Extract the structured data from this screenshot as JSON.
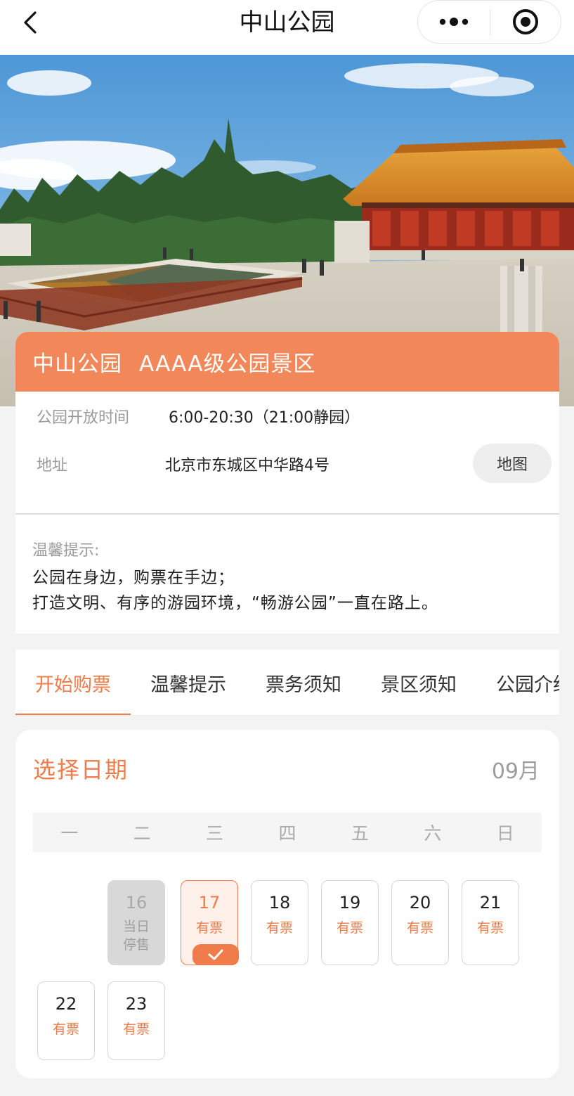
{
  "nav": {
    "title": "中山公园",
    "back_icon": "chevron-left-icon",
    "more_icon": "more-dots-icon",
    "target_icon": "target-icon"
  },
  "hero": {
    "image_subject": "park-palace-photo"
  },
  "park": {
    "name": "中山公园",
    "grade": "AAAA级公园景区",
    "header_color": "#f2875a",
    "hours_label": "公园开放时间",
    "hours_value": "6:00-20:30（21:00静园）",
    "address_label": "地址",
    "address_value": "北京市东城区中华路4号",
    "map_button": "地图"
  },
  "tips": {
    "title": "温馨提示:",
    "lines": [
      "公园在身边，购票在手边；",
      "打造文明、有序的游园环境，“畅游公园”一直在路上。"
    ]
  },
  "tabs": [
    {
      "label": "开始购票",
      "active": true
    },
    {
      "label": "温馨提示",
      "active": false
    },
    {
      "label": "票务须知",
      "active": false
    },
    {
      "label": "景区须知",
      "active": false
    },
    {
      "label": "公园介绍",
      "active": false
    }
  ],
  "date_picker": {
    "title": "选择日期",
    "month": "09月",
    "accent_color": "#ef7c4a",
    "weekdays": [
      "一",
      "二",
      "三",
      "四",
      "五",
      "六",
      "日"
    ],
    "days": [
      {
        "day": "16",
        "status": "当日停售",
        "status_line1": "当日",
        "status_line2": "停售",
        "state": "disabled"
      },
      {
        "day": "17",
        "status": "有票",
        "state": "selected"
      },
      {
        "day": "18",
        "status": "有票",
        "state": "available"
      },
      {
        "day": "19",
        "status": "有票",
        "state": "available"
      },
      {
        "day": "20",
        "status": "有票",
        "state": "available"
      },
      {
        "day": "21",
        "status": "有票",
        "state": "available"
      },
      {
        "day": "22",
        "status": "有票",
        "state": "available"
      },
      {
        "day": "23",
        "status": "有票",
        "state": "available"
      }
    ],
    "selected_icon": "check-icon"
  }
}
